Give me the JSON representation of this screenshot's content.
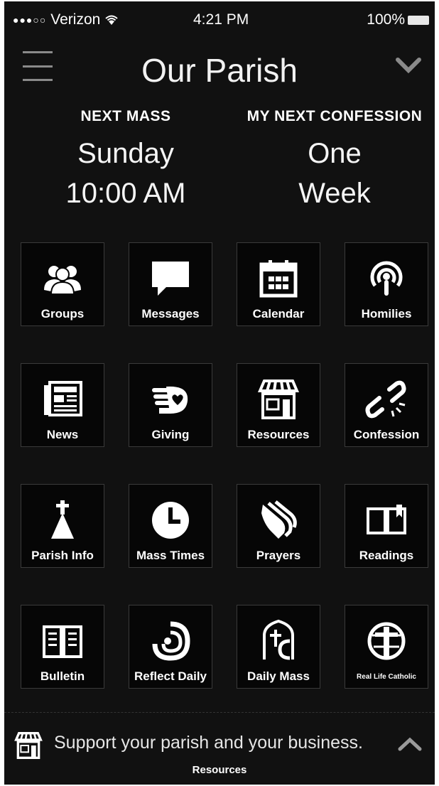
{
  "status_bar": {
    "signal": "●●●○○",
    "carrier": "Verizon",
    "time": "4:21 PM",
    "battery": "100%"
  },
  "header": {
    "title": "Our Parish"
  },
  "next_mass": {
    "label": "NEXT MASS",
    "day": "Sunday",
    "time": "10:00 AM"
  },
  "next_confession": {
    "label": "MY NEXT CONFESSION",
    "line1": "One",
    "line2": "Week"
  },
  "tiles": [
    {
      "label": "Groups",
      "icon": "people-icon"
    },
    {
      "label": "Messages",
      "icon": "speech-bubble-icon"
    },
    {
      "label": "Calendar",
      "icon": "calendar-icon"
    },
    {
      "label": "Homilies",
      "icon": "podcast-icon"
    },
    {
      "label": "News",
      "icon": "newspaper-icon"
    },
    {
      "label": "Giving",
      "icon": "hand-heart-icon"
    },
    {
      "label": "Resources",
      "icon": "storefront-icon"
    },
    {
      "label": "Confession",
      "icon": "broken-link-icon"
    },
    {
      "label": "Parish Info",
      "icon": "church-icon"
    },
    {
      "label": "Mass Times",
      "icon": "clock-icon"
    },
    {
      "label": "Prayers",
      "icon": "praying-hands-icon"
    },
    {
      "label": "Readings",
      "icon": "open-book-icon"
    },
    {
      "label": "Bulletin",
      "icon": "bulletin-book-icon"
    },
    {
      "label": "Reflect Daily",
      "icon": "reflect-daily-logo-icon"
    },
    {
      "label": "Daily Mass",
      "icon": "daily-mass-logo-icon"
    },
    {
      "label": "Real Life Catholic",
      "icon": "real-life-catholic-logo-icon"
    }
  ],
  "footer": {
    "banner_text": "Support your parish and your business.",
    "label": "Resources"
  },
  "colors": {
    "background": "#111111",
    "tile_background": "#060606",
    "text": "#ffffff"
  }
}
